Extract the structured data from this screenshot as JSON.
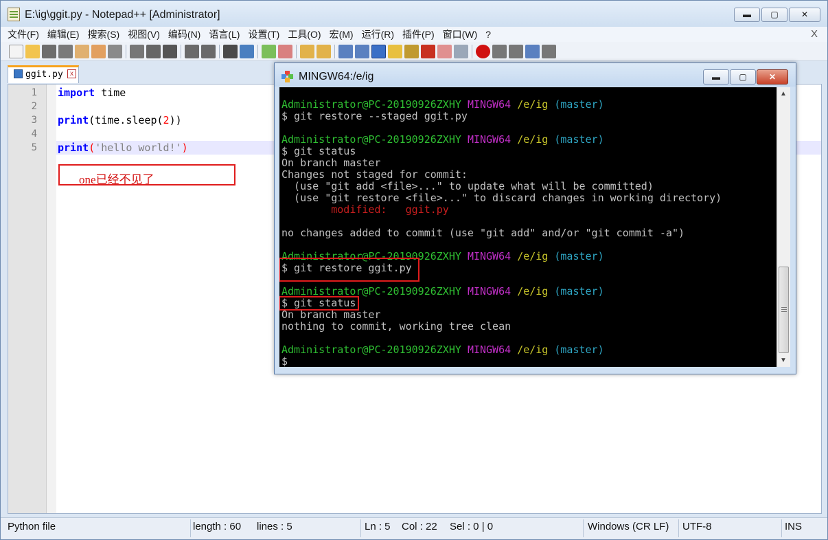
{
  "npp": {
    "title": "E:\\ig\\ggit.py - Notepad++ [Administrator]",
    "window_buttons": [
      "▬",
      "▢",
      "✕"
    ],
    "menu": [
      "文件(F)",
      "编辑(E)",
      "搜索(S)",
      "视图(V)",
      "编码(N)",
      "语言(L)",
      "设置(T)",
      "工具(O)",
      "宏(M)",
      "运行(R)",
      "插件(P)",
      "窗口(W)",
      "?"
    ],
    "menu_close": "X",
    "tab": {
      "label": "ggit.py",
      "close": "x"
    },
    "lines": [
      "1",
      "2",
      "3",
      "4",
      "5"
    ],
    "code": {
      "l1_kw": "import",
      "l1_rest": " time",
      "l3_kw": "print",
      "l3_a": "(time.sleep(",
      "l3_num": "2",
      "l3_b": "))",
      "l5_kw": "print",
      "l5_open": "(",
      "l5_str": "'hello world!'",
      "l5_close": ")"
    },
    "annotation": "one已经不见了",
    "status": {
      "type": "Python file",
      "length": "length : 60",
      "lines": "lines : 5",
      "ln": "Ln : 5",
      "col": "Col : 22",
      "sel": "Sel : 0 | 0",
      "eol": "Windows (CR LF)",
      "enc": "UTF-8",
      "mode": "INS"
    }
  },
  "mingw": {
    "title": "MINGW64:/e/ig",
    "window_buttons": [
      "▬",
      "▢",
      "✕"
    ],
    "prompt": {
      "user": "Administrator@PC-20190926ZXHY",
      "sys": "MINGW64",
      "path": "/e/ig",
      "branch": "(master)"
    },
    "terminal": {
      "cmd1": "$ git restore --staged ggit.py",
      "cmd2": "$ git status",
      "out1": "On branch master",
      "out2": "Changes not staged for commit:",
      "out3": "  (use \"git add <file>...\" to update what will be committed)",
      "out4": "  (use \"git restore <file>...\" to discard changes in working directory)",
      "out5": "        modified:   ggit.py",
      "out6": "no changes added to commit (use \"git add\" and/or \"git commit -a\")",
      "cmd3": "$ git restore ggit.py",
      "cmd4": "$ git status",
      "out7": "On branch master",
      "out8": "nothing to commit, working tree clean",
      "cmd5": "$"
    },
    "colors": {
      "green": "#2fbf32",
      "magenta": "#c02fc6",
      "yellow": "#c7c42a",
      "cyan": "#2fa7c5",
      "red": "#c81e1e"
    }
  }
}
